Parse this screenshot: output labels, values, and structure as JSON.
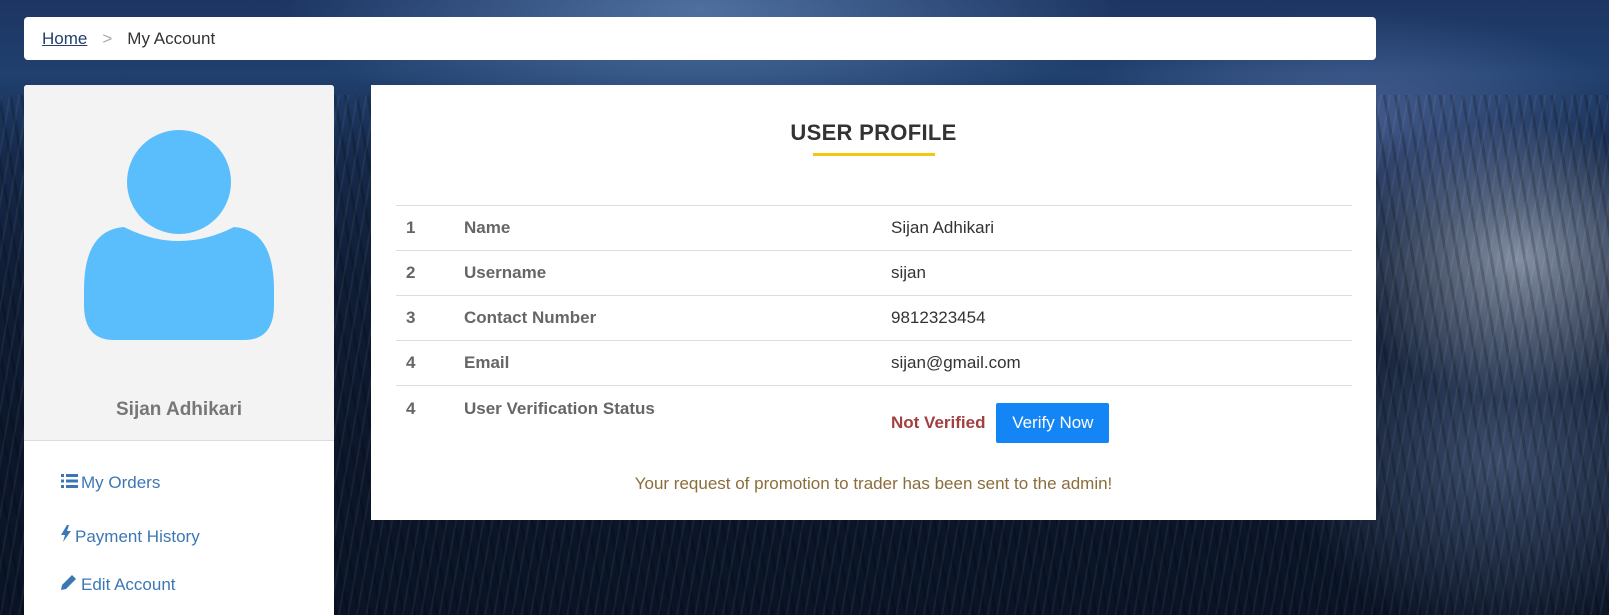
{
  "breadcrumb": {
    "home": "Home",
    "separator": ">",
    "current": "My Account"
  },
  "sidebar": {
    "user_name": "Sijan Adhikari",
    "menu": [
      {
        "label": "My Orders",
        "icon": "list-icon"
      },
      {
        "label": "Payment History",
        "icon": "bolt-icon"
      },
      {
        "label": "Edit Account",
        "icon": "pencil-icon"
      }
    ]
  },
  "profile": {
    "title": "USER PROFILE",
    "rows": [
      {
        "num": "1",
        "label": "Name",
        "value": "Sijan Adhikari"
      },
      {
        "num": "2",
        "label": "Username",
        "value": "sijan"
      },
      {
        "num": "3",
        "label": "Contact Number",
        "value": "9812323454"
      },
      {
        "num": "4",
        "label": "Email",
        "value": "sijan@gmail.com"
      },
      {
        "num": "4",
        "label": "User Verification Status",
        "status": "Not Verified",
        "action": "Verify Now"
      }
    ],
    "message": "Your request of promotion to trader has been sent to the admin!"
  },
  "colors": {
    "accent": "#f2c811",
    "avatar": "#5bbefc",
    "link": "#3c77b5",
    "status_unverified": "#a33f3f",
    "button": "#1485f5",
    "message": "#8a6d3b"
  }
}
